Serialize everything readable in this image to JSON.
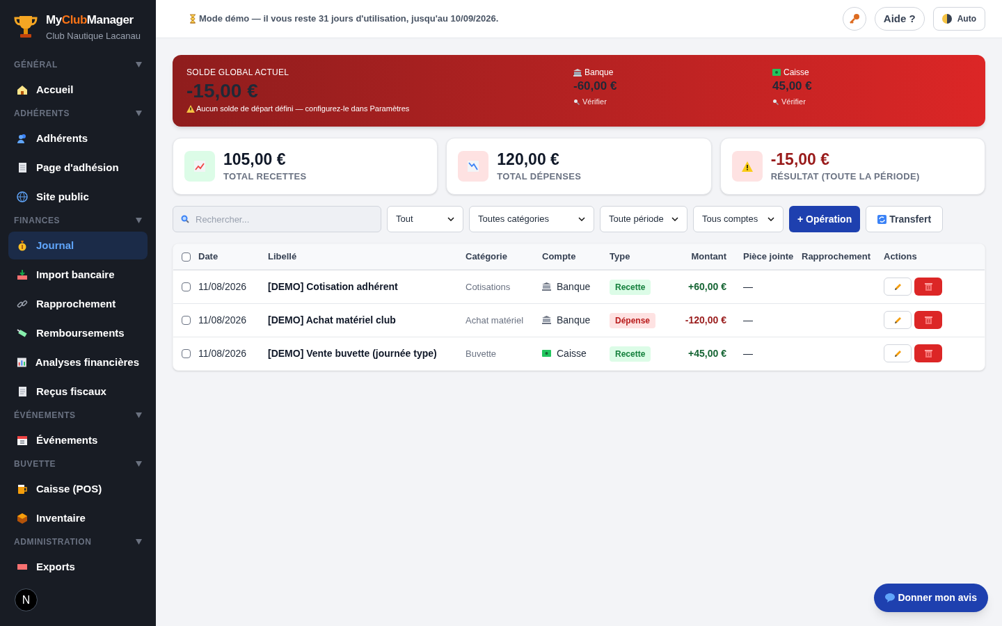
{
  "brand": {
    "parts": [
      {
        "text": "My",
        "highlight": false
      },
      {
        "text": "Club",
        "highlight": true
      },
      {
        "text": "Manager",
        "highlight": false
      }
    ],
    "subtitle": "Club Nautique Lacanau"
  },
  "sidebar": {
    "sections": [
      {
        "title": "GÉNÉRAL",
        "expanded": true,
        "items": [
          {
            "label": "Accueil",
            "selected": false
          }
        ]
      },
      {
        "title": "ADHÉRENTS",
        "expanded": true,
        "items": [
          {
            "label": "Adhérents",
            "selected": false
          },
          {
            "label": "Page d'adhésion",
            "selected": false
          },
          {
            "label": "Site public",
            "selected": false
          }
        ]
      },
      {
        "title": "FINANCES",
        "expanded": true,
        "items": [
          {
            "label": "Journal",
            "selected": true
          },
          {
            "label": "Import bancaire",
            "selected": false
          },
          {
            "label": "Rapprochement",
            "selected": false
          },
          {
            "label": "Remboursements",
            "selected": false
          },
          {
            "label": "Analyses financières",
            "selected": false
          },
          {
            "label": "Reçus fiscaux",
            "selected": false
          }
        ]
      },
      {
        "title": "ÉVÉNEMENTS",
        "expanded": true,
        "items": [
          {
            "label": "Événements",
            "selected": false
          }
        ]
      },
      {
        "title": "BUVETTE",
        "expanded": true,
        "items": [
          {
            "label": "Caisse (POS)",
            "selected": false
          },
          {
            "label": "Inventaire",
            "selected": false
          }
        ]
      },
      {
        "title": "ADMINISTRATION",
        "expanded": true,
        "items": [
          {
            "label": "Exports",
            "selected": false
          }
        ]
      }
    ]
  },
  "dev_badge": "N",
  "header": {
    "notice": "Mode démo — il vous reste 31 jours d'utilisation, jusqu'au 10/09/2026.",
    "help": "Aide ?",
    "theme": "Auto"
  },
  "balance": {
    "title": "SOLDE GLOBAL ACTUEL",
    "amount": "-15,00 €",
    "warning": "Aucun solde de départ défini — configurez-le dans Paramètres",
    "accounts": [
      {
        "name": "Banque",
        "amount": "-60,00 €",
        "link": "Vérifier"
      },
      {
        "name": "Caisse",
        "amount": "45,00 €",
        "link": "Vérifier"
      }
    ]
  },
  "stats": [
    {
      "value": "105,00 €",
      "label": "TOTAL RECETTES",
      "kind": "income"
    },
    {
      "value": "120,00 €",
      "label": "TOTAL DÉPENSES",
      "kind": "expense"
    },
    {
      "value": "-15,00 €",
      "label": "RÉSULTAT (TOUTE LA PÉRIODE)",
      "kind": "result"
    }
  ],
  "filters": {
    "search": {
      "placeholder": "Rechercher..."
    },
    "selects": [
      "Tout",
      "Toutes catégories",
      "Toute période",
      "Tous comptes"
    ],
    "add_button": "+ Opération",
    "transfer_button": "Transfert"
  },
  "table": {
    "select_all_checked": false,
    "columns": [
      "Date",
      "Libellé",
      "Catégorie",
      "Compte",
      "Type",
      "Montant",
      "Pièce jointe",
      "Rapprochement",
      "Actions"
    ],
    "rows": [
      {
        "checked": false,
        "date": "11/08/2026",
        "label": "[DEMO] Cotisation adhérent",
        "category": "Cotisations",
        "account": {
          "name": "Banque",
          "kind": "bank"
        },
        "type": {
          "label": "Recette",
          "kind": "income"
        },
        "amount": "+60,00 €",
        "attachment": "—"
      },
      {
        "checked": false,
        "date": "11/08/2026",
        "label": "[DEMO] Achat matériel club",
        "category": "Achat matériel",
        "account": {
          "name": "Banque",
          "kind": "bank"
        },
        "type": {
          "label": "Dépense",
          "kind": "expense"
        },
        "amount": "-120,00 €",
        "attachment": "—"
      },
      {
        "checked": false,
        "date": "11/08/2026",
        "label": "[DEMO] Vente buvette (journée type)",
        "category": "Buvette",
        "account": {
          "name": "Caisse",
          "kind": "cash"
        },
        "type": {
          "label": "Recette",
          "kind": "income"
        },
        "amount": "+45,00 €",
        "attachment": "—"
      }
    ]
  },
  "feedback_button": "Donner mon avis"
}
